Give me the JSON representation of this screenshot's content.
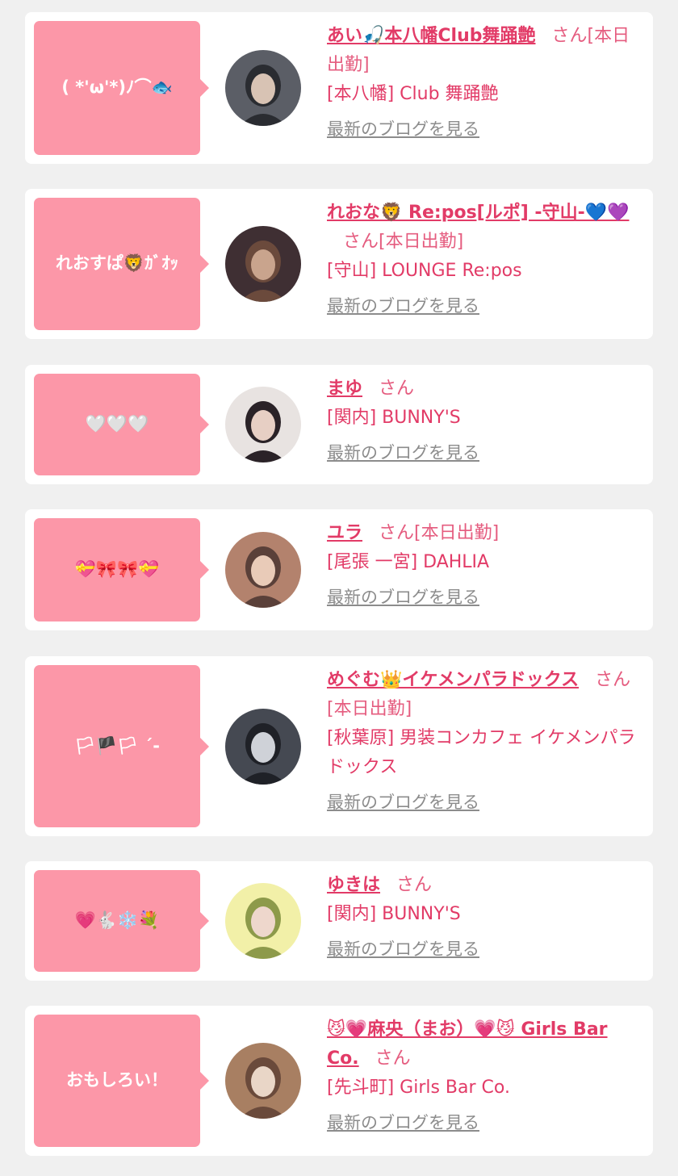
{
  "colors": {
    "background": "#f0f0f0",
    "card": "#ffffff",
    "bubble": "#fc97a8",
    "name": "#e23b67",
    "link_gray": "#8c8c8c"
  },
  "entries": [
    {
      "bubble_text": "( *'ω'*)ﾉ⌒🐟",
      "cast_name": "あい🎣本八幡Club舞踊艶",
      "honorific": "さん[本日出勤]",
      "shop": "[本八幡] Club 舞踊艶",
      "blog_link": "最新のブログを見る",
      "avatar_icon": "cast-photo"
    },
    {
      "bubble_text": "れおすぱ🦁ｶﾞｵｯ",
      "cast_name": "れおな🦁 Re:pos[ルポ] -守山-💙💜",
      "honorific": "さん[本日出勤]",
      "shop": "[守山] LOUNGE Re:pos",
      "blog_link": "最新のブログを見る",
      "avatar_icon": "cast-photo"
    },
    {
      "bubble_text": "🤍🤍🤍",
      "cast_name": "まゆ",
      "honorific": "さん",
      "shop": "[関内] BUNNY'S",
      "blog_link": "最新のブログを見る",
      "avatar_icon": "cast-photo"
    },
    {
      "bubble_text": "💝🎀🎀💝",
      "cast_name": "ユラ",
      "honorific": "さん[本日出勤]",
      "shop": "[尾張 一宮] DAHLIA",
      "blog_link": "最新のブログを見る",
      "avatar_icon": "cast-photo"
    },
    {
      "bubble_text": "🏳🏴🏳 ´-",
      "cast_name": "めぐむ👑イケメンパラドックス",
      "honorific": "さん[本日出勤]",
      "shop": "[秋葉原] 男装コンカフェ イケメンパラドックス",
      "blog_link": "最新のブログを見る",
      "avatar_icon": "cast-photo"
    },
    {
      "bubble_text": "💗🐇❄️💐",
      "cast_name": "ゆきは",
      "honorific": "さん",
      "shop": "[関内] BUNNY'S",
      "blog_link": "最新のブログを見る",
      "avatar_icon": "cast-photo"
    },
    {
      "bubble_text": "おもしろい！",
      "cast_name": "😼💗麻央（まお）💗😼 Girls Bar Co.",
      "honorific": "さん",
      "shop": "[先斗町] Girls Bar Co.",
      "blog_link": "最新のブログを見る",
      "avatar_icon": "cast-photo"
    }
  ]
}
